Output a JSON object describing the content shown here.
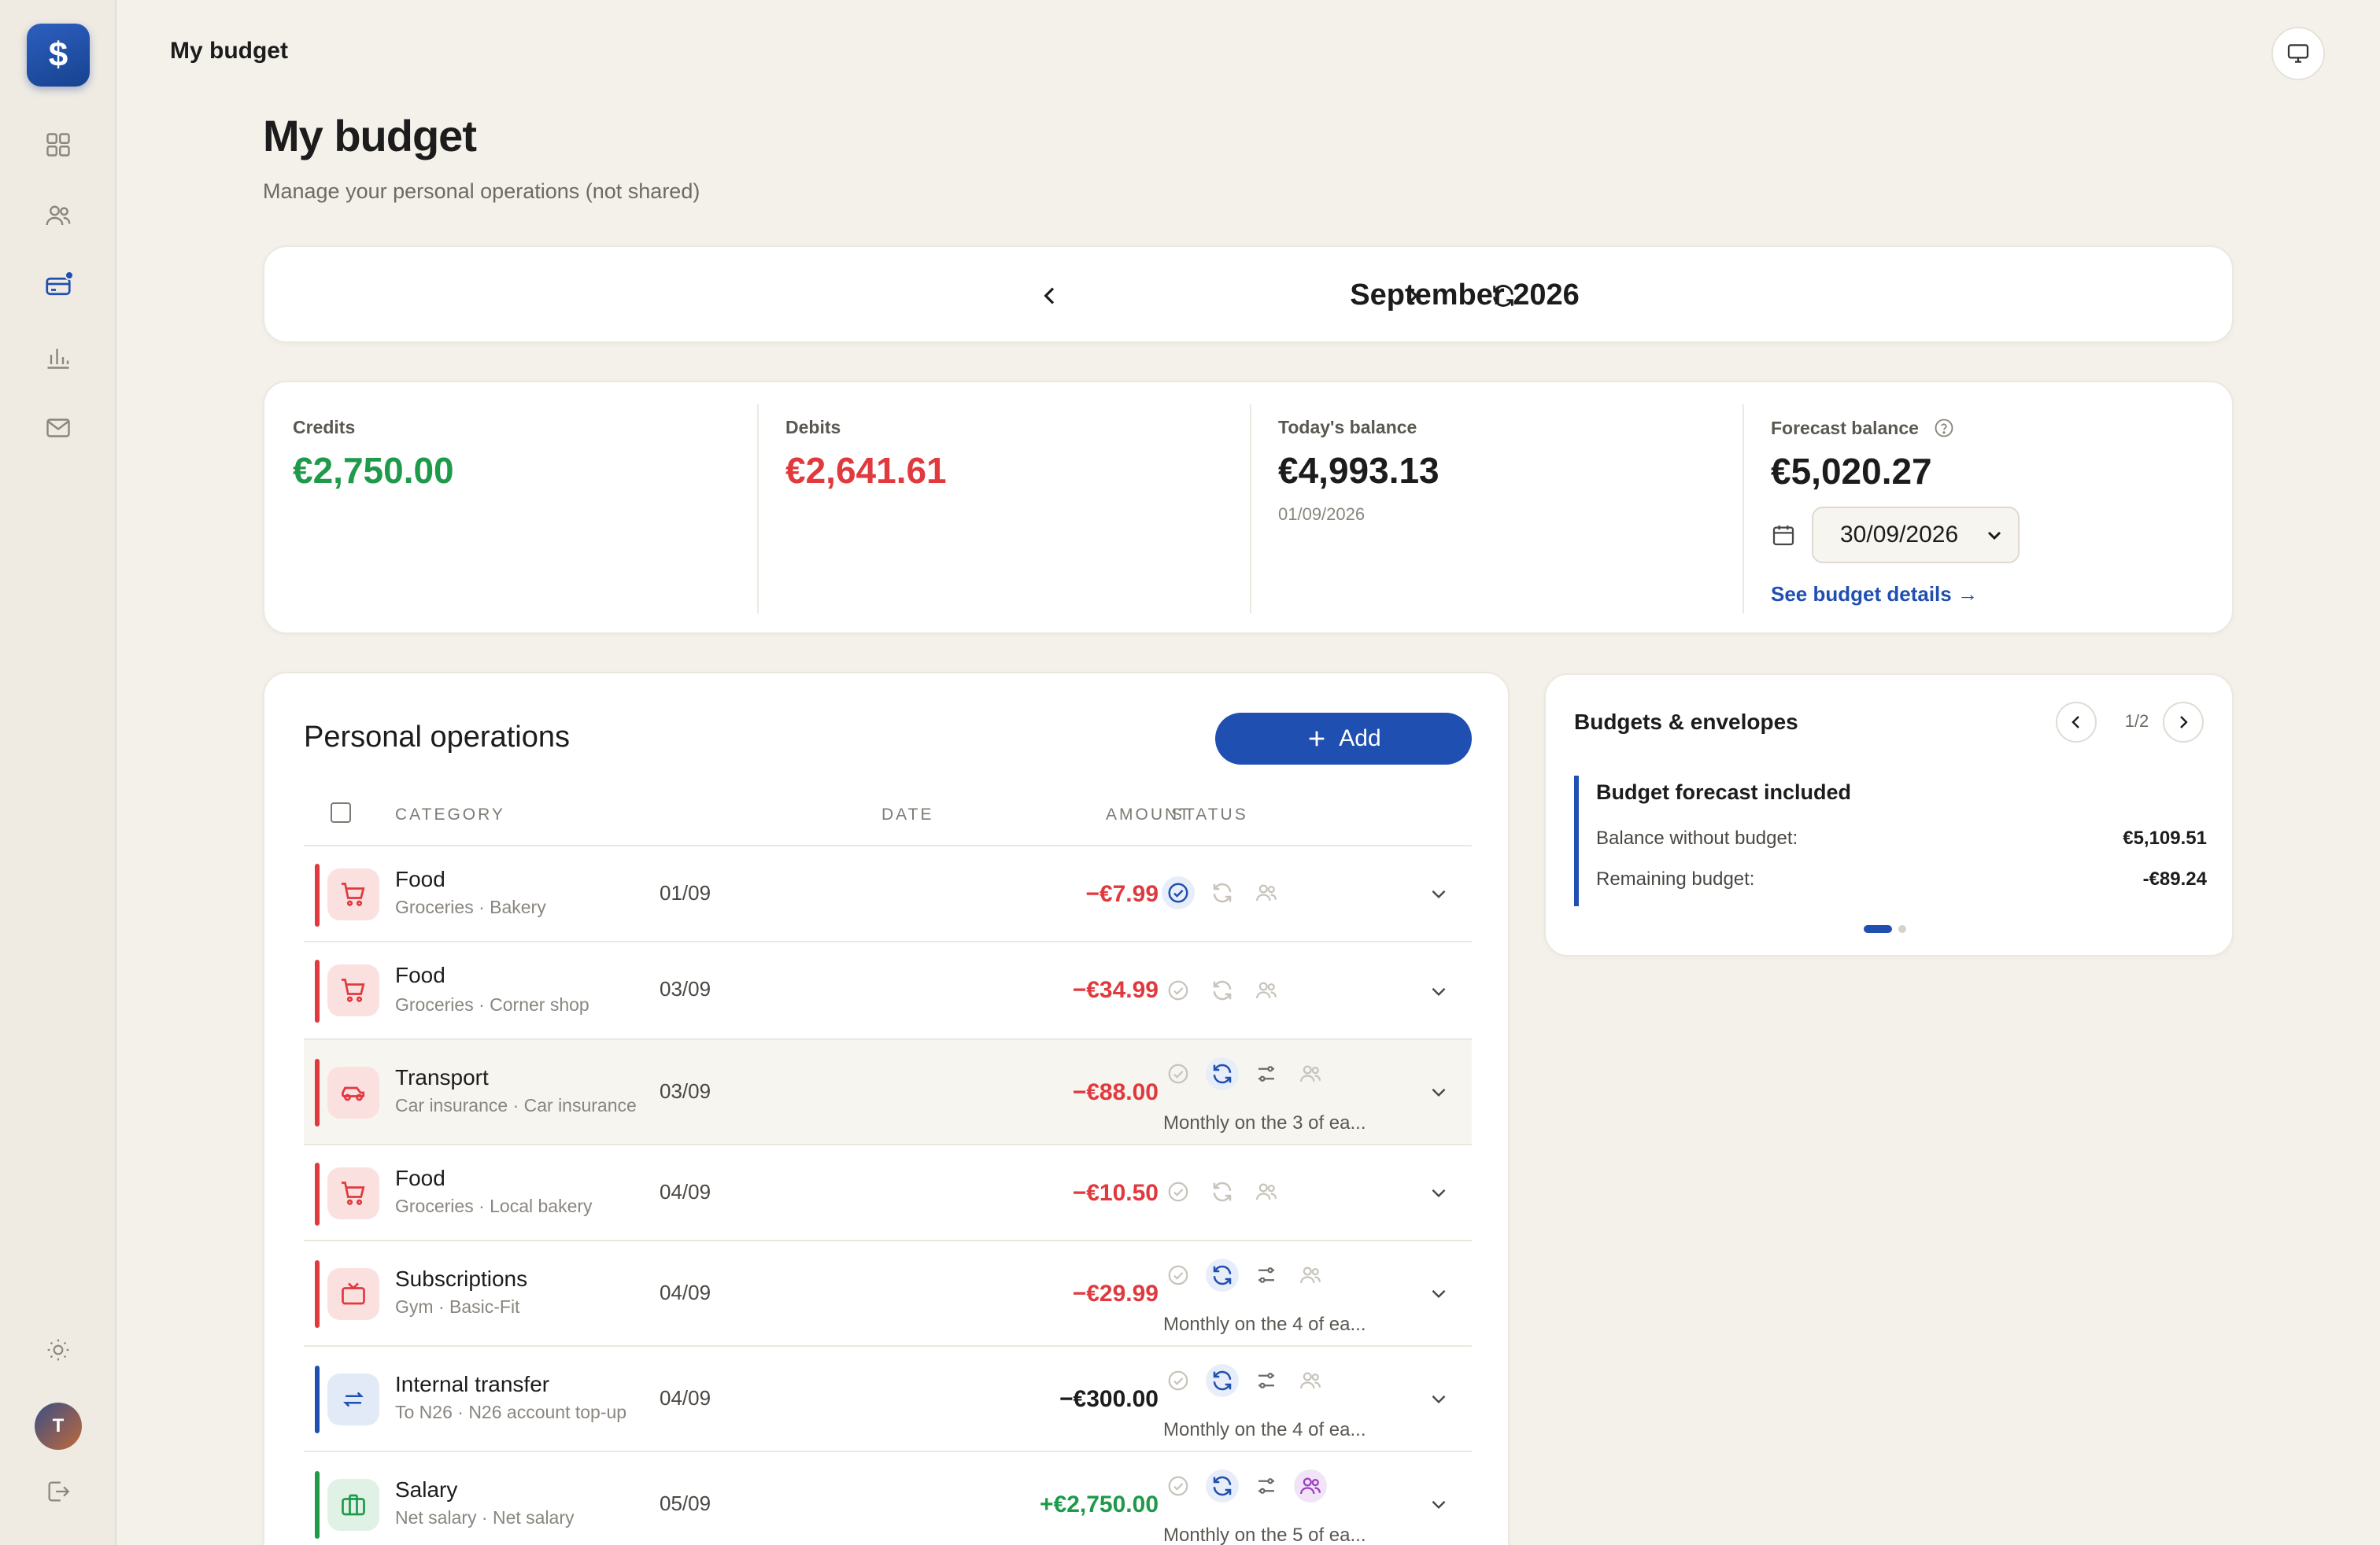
{
  "app": {
    "logo_symbol": "$",
    "header_title": "My budget"
  },
  "sidebar": {
    "items": [
      {
        "icon": "dashboard-grid-icon"
      },
      {
        "icon": "users-icon"
      },
      {
        "icon": "card-icon",
        "active": true
      },
      {
        "icon": "bar-chart-icon"
      },
      {
        "icon": "mail-icon"
      }
    ],
    "user_initial": "T"
  },
  "page": {
    "title": "My budget",
    "subtitle": "Manage your personal operations (not shared)"
  },
  "month": {
    "label": "September 2026"
  },
  "summary": {
    "credits": {
      "label": "Credits",
      "value": "€2,750.00"
    },
    "debits": {
      "label": "Debits",
      "value": "€2,641.61"
    },
    "today": {
      "label": "Today's balance",
      "value": "€4,993.13",
      "date": "01/09/2026"
    },
    "forecast": {
      "label": "Forecast balance",
      "value": "€5,020.27",
      "date_value": "30/09/2026",
      "link": "See budget details →"
    }
  },
  "operations": {
    "title": "Personal operations",
    "add_label": "Add",
    "headers": {
      "category": "CATEGORY",
      "date": "DATE",
      "amount": "AMOUNT",
      "status": "STATUS"
    },
    "rows": [
      {
        "category": "Food",
        "sub": "Groceries · Bakery",
        "date": "01/09",
        "amount": "−€7.99"
      },
      {
        "category": "Food",
        "sub": "Groceries · Corner shop",
        "date": "03/09",
        "amount": "−€34.99"
      },
      {
        "category": "Transport",
        "sub": "Car insurance · Car insurance",
        "date": "03/09",
        "amount": "−€88.00",
        "note": "Monthly on the 3 of ea..."
      },
      {
        "category": "Food",
        "sub": "Groceries · Local bakery",
        "date": "04/09",
        "amount": "−€10.50"
      },
      {
        "category": "Subscriptions",
        "sub": "Gym · Basic-Fit",
        "date": "04/09",
        "amount": "−€29.99",
        "note": "Monthly on the 4 of ea..."
      },
      {
        "category": "Internal transfer",
        "sub": "To N26 · N26 account top-up",
        "date": "04/09",
        "amount": "−€300.00",
        "note": "Monthly on the 4 of ea..."
      },
      {
        "category": "Salary",
        "sub": "Net salary · Net salary",
        "date": "05/09",
        "amount": "+€2,750.00",
        "note": "Monthly on the 5 of ea..."
      }
    ]
  },
  "budgets": {
    "title": "Budgets & envelopes",
    "pager": "1/2",
    "box_title": "Budget forecast included",
    "without_label": "Balance without budget:",
    "without_value": "€5,109.51",
    "remaining_label": "Remaining budget:",
    "remaining_value": "-€89.24"
  },
  "colors": {
    "accent": "#1f4fb0",
    "credit": "#1e9a4a",
    "debit": "#e0393e"
  }
}
